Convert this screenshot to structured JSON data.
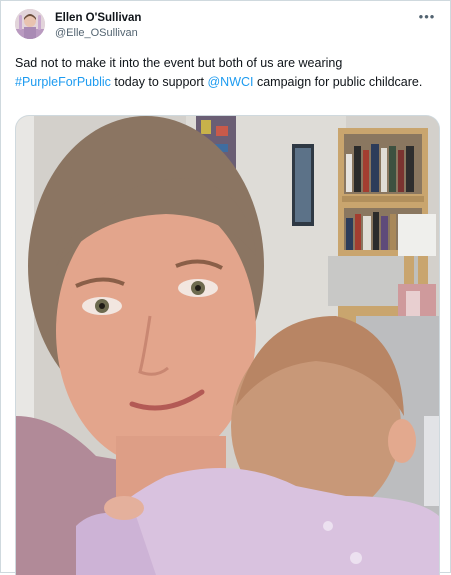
{
  "user": {
    "display_name": "Ellen O'Sullivan",
    "handle": "@Elle_OSullivan"
  },
  "tweet": {
    "text_part1": "Sad not to make it into the event but both of us are wearing ",
    "hashtag": "#PurpleForPublic",
    "text_part2": " today to support ",
    "mention": "@NWCI",
    "text_part3": " campaign for public childcare."
  },
  "more_icon": "more-horizontal-icon",
  "colors": {
    "link": "#1d9bf0",
    "text": "#0f1419",
    "secondary": "#536471",
    "border": "#cfd9de"
  }
}
